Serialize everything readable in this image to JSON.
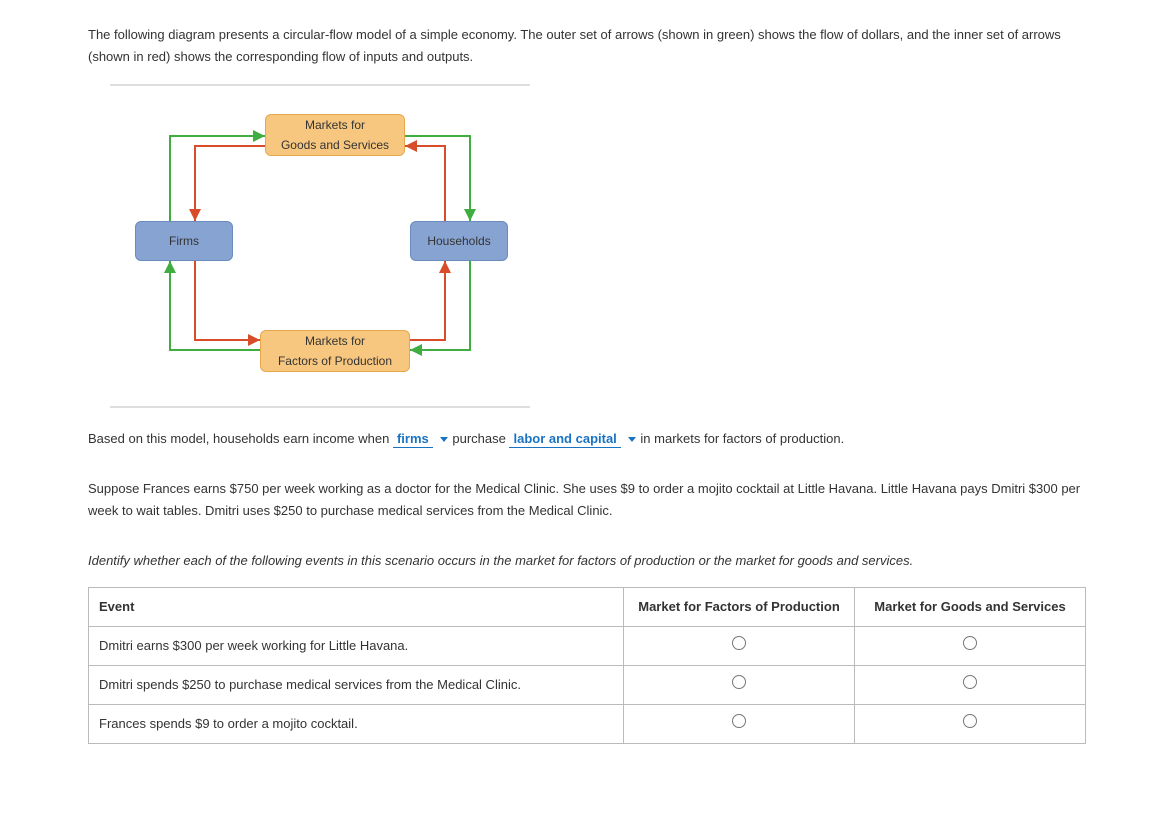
{
  "intro": "The following diagram presents a circular-flow model of a simple economy. The outer set of arrows (shown in green) shows the flow of dollars, and the inner set of arrows (shown in red) shows the corresponding flow of inputs and outputs.",
  "nodes": {
    "top": "Markets for\nGoods and Services",
    "left": "Firms",
    "right": "Households",
    "bottom": "Markets for\nFactors of Production"
  },
  "q1": {
    "prefix": "Based on this model, households earn income when ",
    "blank1": "firms",
    "mid": " purchase ",
    "blank2": "labor and capital",
    "suffix": " in markets for factors of production."
  },
  "scenario": "Suppose Frances earns $750 per week working as a doctor for the Medical Clinic. She uses $9 to order a mojito cocktail at Little Havana. Little Havana pays Dmitri $300 per week to wait tables. Dmitri uses $250 to purchase medical services from the Medical Clinic.",
  "instruction": "Identify whether each of the following events in this scenario occurs in the market for factors of production or the market for goods and services.",
  "table": {
    "headers": {
      "event": "Event",
      "factors": "Market for Factors of Production",
      "goods": "Market for Goods and Services"
    },
    "rows": [
      "Dmitri earns $300 per week working for Little Havana.",
      "Dmitri spends $250 to purchase medical services from the Medical Clinic.",
      "Frances spends $9 to order a mojito cocktail."
    ]
  }
}
